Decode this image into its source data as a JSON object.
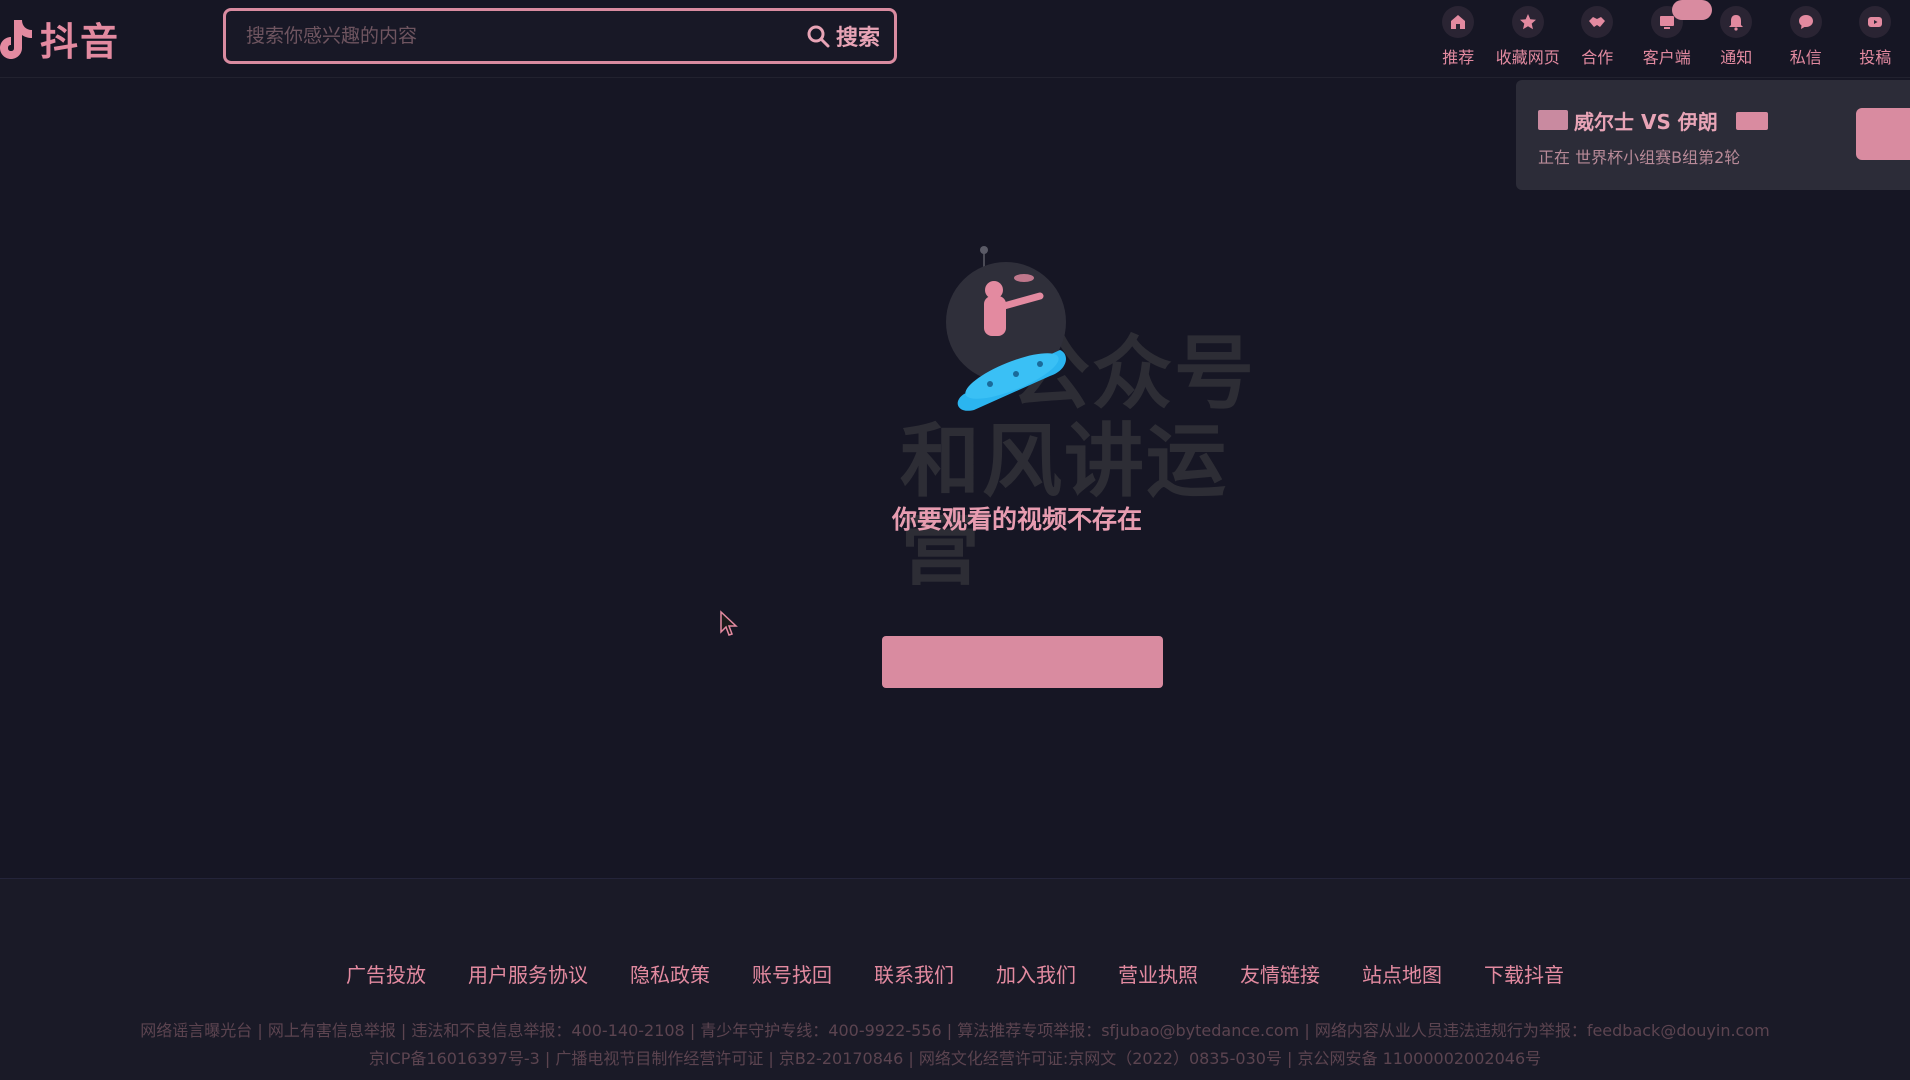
{
  "header": {
    "logo_text": "抖音",
    "search": {
      "placeholder": "搜索你感兴趣的内容",
      "button_label": "搜索"
    },
    "nav": [
      {
        "label": "推荐",
        "icon": "home-icon"
      },
      {
        "label": "收藏网页",
        "icon": "star-icon"
      },
      {
        "label": "合作",
        "icon": "handshake-icon"
      },
      {
        "label": "客户端",
        "icon": "desktop-icon"
      },
      {
        "label": "通知",
        "icon": "bell-icon"
      },
      {
        "label": "私信",
        "icon": "chat-icon"
      },
      {
        "label": "投稿",
        "icon": "upload-icon"
      }
    ]
  },
  "live_banner": {
    "title": "威尔士 VS 伊朗",
    "subtitle": "正在 世界杯小组赛B组第2轮"
  },
  "main": {
    "watermark_line1": "公众号",
    "watermark_line2": "和风讲运营",
    "error_message": "你要观看的视频不存在"
  },
  "footer": {
    "links": [
      "广告投放",
      "用户服务协议",
      "隐私政策",
      "账号找回",
      "联系我们",
      "加入我们",
      "营业执照",
      "友情链接",
      "站点地图",
      "下载抖音"
    ],
    "line1": "网络谣言曝光台 | 网上有害信息举报 | 违法和不良信息举报：400-140-2108 | 青少年守护专线：400-9922-556 | 算法推荐专项举报：sfjubao@bytedance.com | 网络内容从业人员违法违规行为举报：feedback@douyin.com",
    "line2": "京ICP备16016397号-3 | 广播电视节目制作经营许可证 | 京B2-20170846 | 网络文化经营许可证:京网文（2022）0835-030号 | 京公网安备 11000002002046号"
  },
  "colors": {
    "accent": "#d98ba0",
    "background": "#161624",
    "footer_bg": "#1a1a27",
    "illustration_blue": "#2bb5f0"
  }
}
